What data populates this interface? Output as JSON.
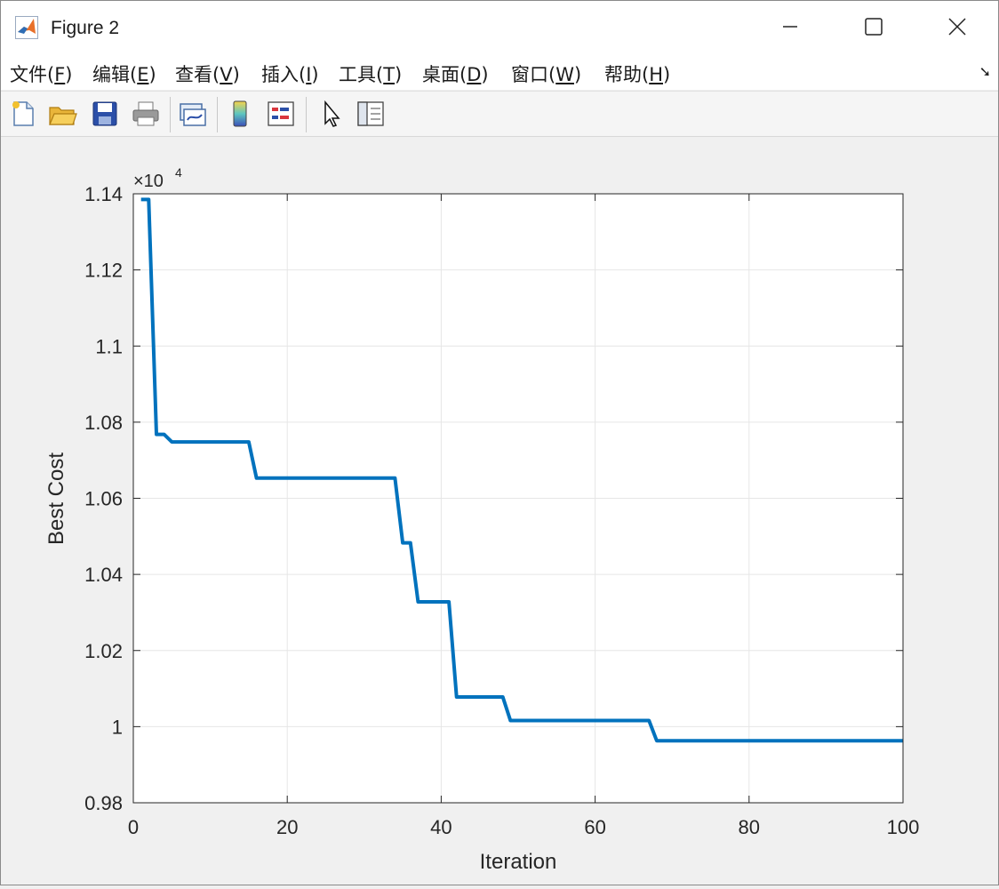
{
  "window": {
    "title": "Figure 2"
  },
  "menu": {
    "items": [
      {
        "label": "文件(",
        "key": "F",
        "tail": ")"
      },
      {
        "label": "编辑(",
        "key": "E",
        "tail": ")"
      },
      {
        "label": "查看(",
        "key": "V",
        "tail": ")"
      },
      {
        "label": "插入(",
        "key": "I",
        "tail": ")"
      },
      {
        "label": "工具(",
        "key": "T",
        "tail": ")"
      },
      {
        "label": "桌面(",
        "key": "D",
        "tail": ")"
      },
      {
        "label": "窗口(",
        "key": "W",
        "tail": ")"
      },
      {
        "label": "帮助(",
        "key": "H",
        "tail": ")"
      }
    ]
  },
  "toolbar": {
    "icons": [
      "new-figure-icon",
      "open-file-icon",
      "save-icon",
      "print-icon",
      "link-plot-icon",
      "colorbar-icon",
      "legend-icon",
      "pointer-icon",
      "property-inspector-icon"
    ]
  },
  "colors": {
    "line": "#0072BD",
    "grid": "#e6e6e6",
    "axis": "#262626"
  },
  "chart_data": {
    "type": "line",
    "title": "",
    "xlabel": "Iteration",
    "ylabel": "Best Cost",
    "y_exponent": "×10",
    "y_exponent_power": "4",
    "xlim": [
      0,
      100
    ],
    "ylim": [
      0.98,
      1.14
    ],
    "xticks": [
      "0",
      "20",
      "40",
      "60",
      "80",
      "100"
    ],
    "yticks": [
      "0.98",
      "1",
      "1.02",
      "1.04",
      "1.06",
      "1.08",
      "1.1",
      "1.12",
      "1.14"
    ],
    "grid": true,
    "series": [
      {
        "x": [
          1,
          2,
          3,
          4,
          5,
          15,
          16,
          34,
          35,
          36,
          37,
          41,
          42,
          48,
          49,
          67,
          68,
          100
        ],
        "y": [
          1.1385,
          1.1385,
          1.0768,
          1.0768,
          1.0748,
          1.0748,
          1.0653,
          1.0653,
          1.0483,
          1.0483,
          1.0328,
          1.0328,
          1.0078,
          1.0078,
          1.0016,
          1.0016,
          0.9963,
          0.9963
        ]
      }
    ]
  }
}
